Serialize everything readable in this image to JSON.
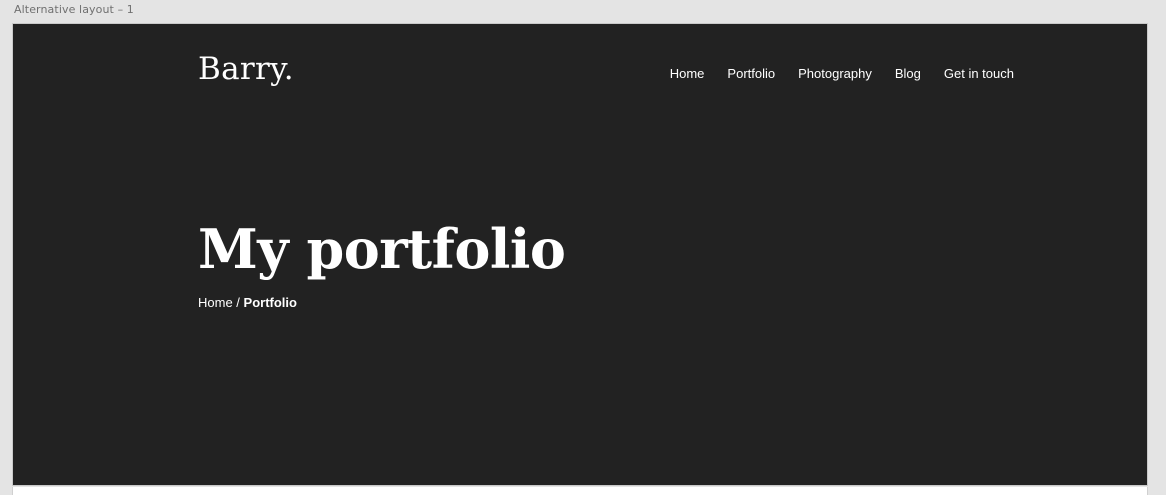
{
  "canvas": {
    "artboard_title": "Alternative layout – 1"
  },
  "header": {
    "logo": "Barry.",
    "nav": [
      {
        "label": "Home"
      },
      {
        "label": "Portfolio"
      },
      {
        "label": "Photography"
      },
      {
        "label": "Blog"
      },
      {
        "label": "Get in touch"
      }
    ]
  },
  "hero": {
    "title": "My portfolio",
    "breadcrumb": {
      "home": "Home",
      "separator": " / ",
      "current": "Portfolio"
    }
  },
  "colors": {
    "background": "#222222",
    "text": "#ffffff",
    "canvas": "#e4e4e4"
  }
}
